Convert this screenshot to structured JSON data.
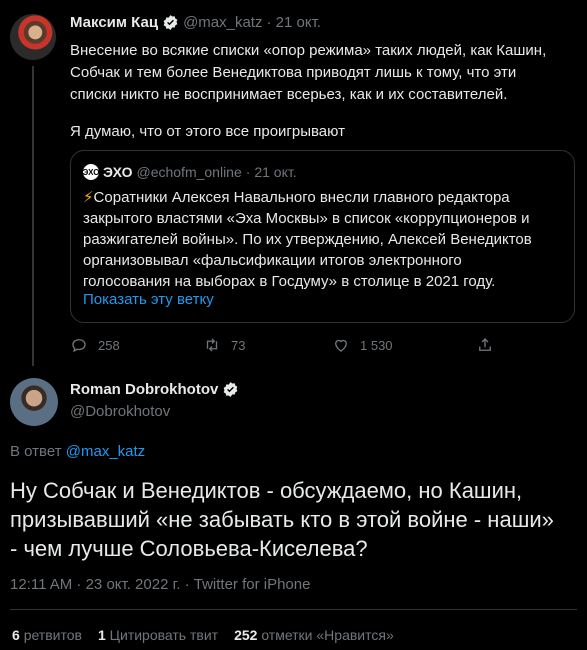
{
  "tweet1": {
    "name": "Максим Кац",
    "handle": "@max_katz",
    "date": "· 21 окт.",
    "text": "Внесение во всякие списки «опор режима» таких людей, как Кашин,\nСобчак и тем более Венедиктова приводят лишь к тому, что эти\nсписки никто не воспринимает всерьез, как и их составителей.",
    "text2": "Я думаю, что от этого все проигрывают",
    "quote": {
      "logo": "ЭХО",
      "name": "ЭХО",
      "handle": "@echofm_online",
      "date": "· 21 окт.",
      "emoji": "⚡",
      "text": "Соратники Алексея Навального внесли главного редактора\nзакрытого властями «Эха Москвы» в список «коррупционеров и\nразжигателей войны». По их утверждению, Алексей Венедиктов\nорганизовывал «фальсификации итогов электронного\nголосования на выборах в Госдуму» в столице в 2021 году.",
      "link": "Показать эту ветку"
    },
    "actions": {
      "replies": "258",
      "retweets": "73",
      "likes": "1 530"
    }
  },
  "tweet2": {
    "name": "Roman Dobrokhotov",
    "handle": "@Dobrokhotov",
    "reply_prefix": "В ответ",
    "reply_to": "@max_katz",
    "text": "Ну Собчак и Венедиктов - обсуждаемо, но Кашин,\nпризывавший «не забывать кто в этой войне - наши»\n- чем лучше Соловьева-Киселева?",
    "meta": "12:11 AM · 23 окт. 2022 г. · Twitter for iPhone",
    "stats": {
      "retweets_count": "6",
      "retweets_label": "ретвитов",
      "quotes_count": "1",
      "quotes_label": "Цитировать твит",
      "likes_count": "252",
      "likes_label": "отметки «Нравится»"
    }
  },
  "colors": {
    "background": "#000000",
    "text": "#e7e9ea",
    "muted": "#71767b",
    "accent": "#1d9bf0",
    "border": "#2f3336"
  }
}
